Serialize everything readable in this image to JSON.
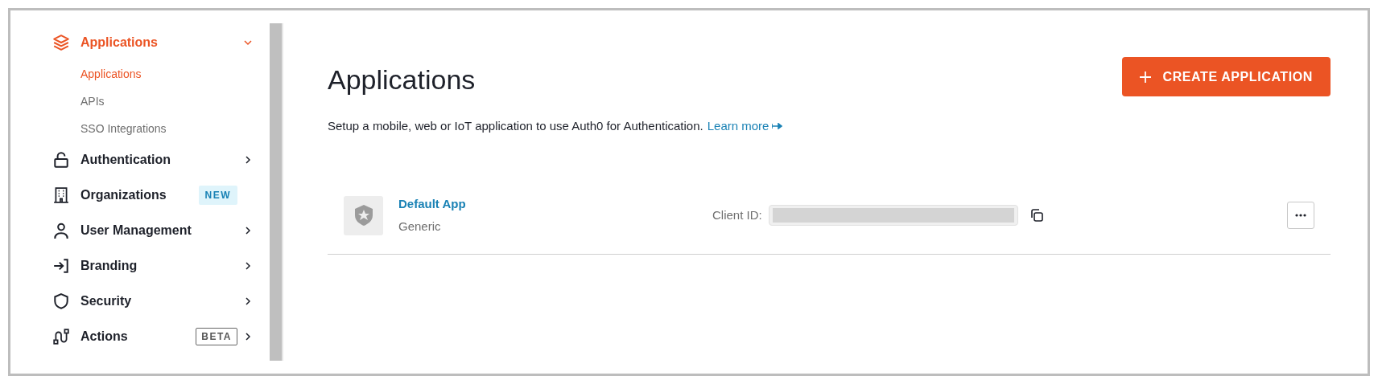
{
  "sidebar": {
    "items": [
      {
        "label": "Applications",
        "selected": true,
        "expanded": true,
        "children": [
          {
            "label": "Applications",
            "selected": true
          },
          {
            "label": "APIs",
            "selected": false
          },
          {
            "label": "SSO Integrations",
            "selected": false
          }
        ]
      },
      {
        "label": "Authentication",
        "selected": false,
        "expanded": false
      },
      {
        "label": "Organizations",
        "selected": false,
        "badge": {
          "text": "NEW",
          "kind": "filled"
        }
      },
      {
        "label": "User Management",
        "selected": false,
        "expanded": false
      },
      {
        "label": "Branding",
        "selected": false,
        "expanded": false
      },
      {
        "label": "Security",
        "selected": false,
        "expanded": false
      },
      {
        "label": "Actions",
        "selected": false,
        "expanded": false,
        "badge": {
          "text": "BETA",
          "kind": "outline"
        }
      }
    ]
  },
  "page": {
    "title": "Applications",
    "description": "Setup a mobile, web or IoT application to use Auth0 for Authentication.",
    "learn_more": "Learn more",
    "create_button": "CREATE APPLICATION"
  },
  "applications": [
    {
      "name": "Default App",
      "type": "Generic",
      "client_id_label": "Client ID:"
    }
  ]
}
